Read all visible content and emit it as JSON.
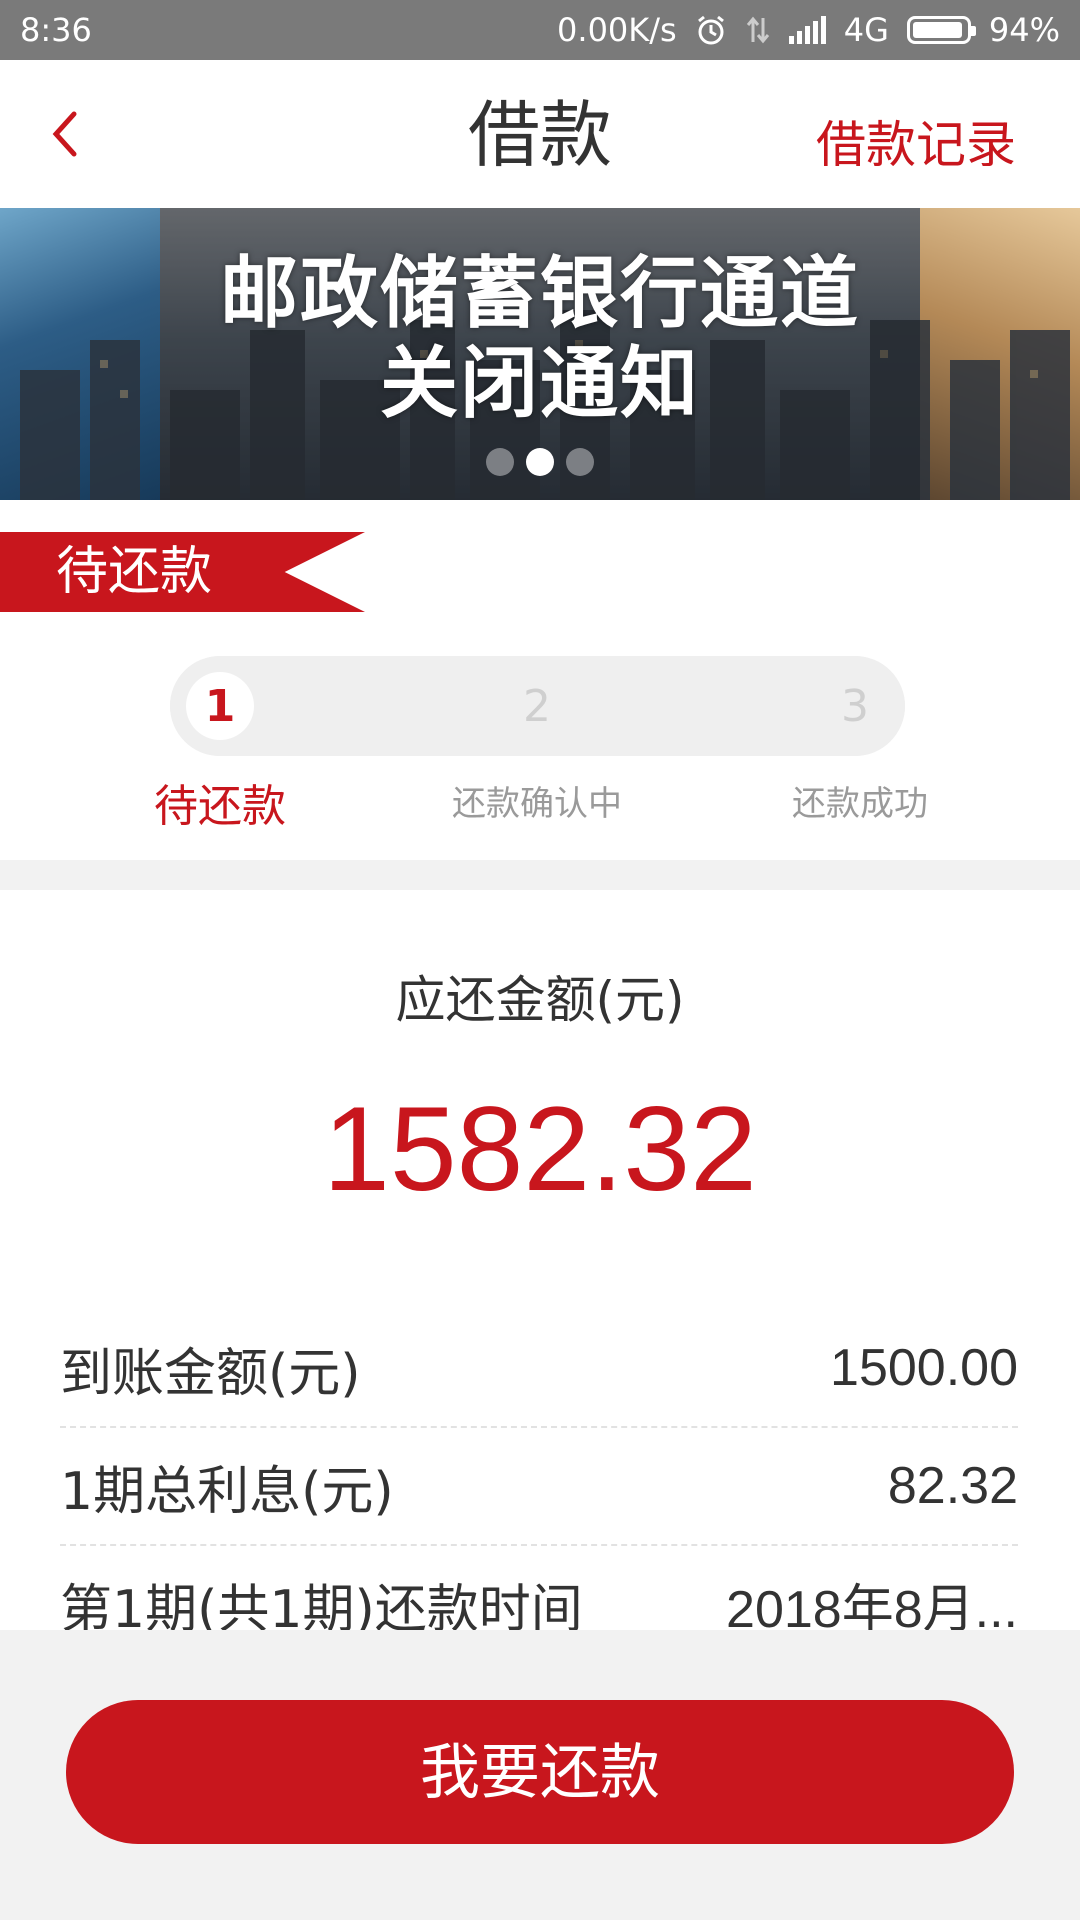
{
  "status_bar": {
    "time": "8:36",
    "network_speed": "0.00K/s",
    "network_type": "4G",
    "battery_percent": "94%",
    "battery_level": 0.94
  },
  "header": {
    "title": "借款",
    "record_link": "借款记录"
  },
  "banner": {
    "line1": "邮政储蓄银行通道",
    "line2": "关闭通知",
    "slides": 3,
    "active_slide": 2
  },
  "progress": {
    "ribbon_label": "待还款",
    "steps": [
      {
        "number": "1",
        "label": "待还款",
        "active": true
      },
      {
        "number": "2",
        "label": "还款确认中",
        "active": false
      },
      {
        "number": "3",
        "label": "还款成功",
        "active": false
      }
    ]
  },
  "amount": {
    "title": "应还金额(元)",
    "value": "1582.32"
  },
  "details": [
    {
      "label": "到账金额(元)",
      "value": "1500.00"
    },
    {
      "label": "1期总利息(元)",
      "value": "82.32"
    },
    {
      "label": "第1期(共1期)还款时间",
      "value": "2018年8月..."
    }
  ],
  "action": {
    "repay_label": "我要还款"
  },
  "colors": {
    "accent": "#c8161d"
  }
}
